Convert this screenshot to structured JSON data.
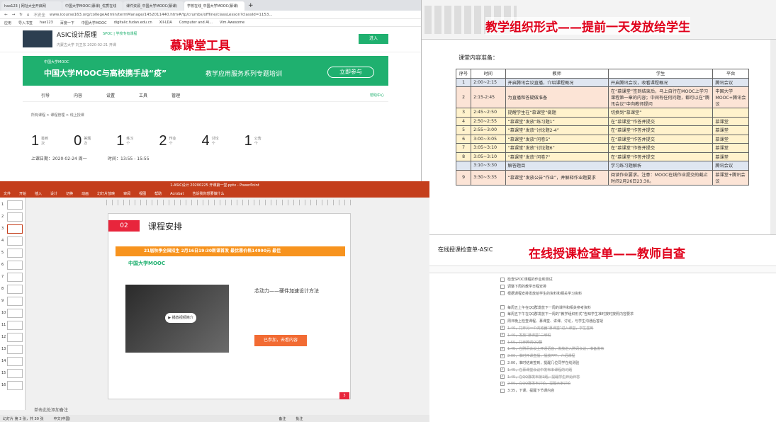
{
  "browser": {
    "tabs": [
      "hao123 | 网址大全开启网",
      "中国大学MOOC(慕课)_优质在线",
      "课件资源_中国大学MOOC(慕课)",
      "学校在线_中国大学MOOC(慕课)"
    ],
    "address": "www.icourse163.org/collegeAdmin/termManage/1452011440.htm#/tp/crumbs/offline/classLesson?classId=1153...",
    "insecure": "不安全",
    "bookmarks": [
      "应用",
      "导入书签",
      "hao123",
      "百度一下",
      "中国大学MOOC",
      "digitalic.fudan.edu.cn",
      "XII-LDA",
      "Computer and AI...",
      "Vim Awesome",
      "其他书签",
      "阅读清单",
      "自动翻译后"
    ],
    "course_title": "ASIC设计原理",
    "course_tags": "SPOC | 学校专有课程",
    "course_meta": "内蒙古大学  刘卫东      2020-02-21 开课",
    "enter_btn": "进入",
    "banner_logo": "中国大学MOOC",
    "banner_main": "中国大学MOOC与高校携手战“疫”",
    "banner_sub": "教学应用服务系列专题培训",
    "banner_btn": "立即参与",
    "subnav": [
      "引导",
      "内容",
      "设置",
      "工具",
      "管理"
    ],
    "help": "帮助中心",
    "breadcrumb": "所有课程  >  课程管理  >  线上授课",
    "stats": [
      {
        "n": "1",
        "l": "签到次"
      },
      {
        "n": "0",
        "l": "答题次"
      },
      {
        "n": "1",
        "l": "练习个"
      },
      {
        "n": "2",
        "l": "作业个"
      },
      {
        "n": "4",
        "l": "讨论个"
      },
      {
        "n": "1",
        "l": "公告个"
      }
    ],
    "date": "上课日期：2020-02-24 周一",
    "time": "时间：13:55 - 15:55"
  },
  "labels": {
    "tool": "慕课堂工具",
    "pdf": "教学组织形式——提前一天发放给学生",
    "check": "在线授课检查单——教师自查"
  },
  "pdf": {
    "heading": "课堂内容准备：",
    "headers": [
      "序号",
      "时间",
      "教师",
      "学生",
      "平台"
    ],
    "rows": [
      {
        "no": "1",
        "time": "2:00~2:15",
        "teacher": "开启腾讯会议直播，介绍课程概况",
        "student": "开启腾讯会议，收看课程概况",
        "platform": "腾讯会议",
        "bg": "#dfe6f1"
      },
      {
        "no": "2",
        "time": "2:15-2:45",
        "teacher": "为直播和答疑做准备",
        "student": "在“慕课堂”签到结束后，马上自行在MOOC上学习课程第一章的内容；中间有任何问题，都可以在“腾讯会议”中向教师提问",
        "platform": "中国大学MOOC+腾讯会议",
        "bg": "#fce4d6"
      },
      {
        "no": "3",
        "time": "2:45~2:50",
        "teacher": "提醒学生在“慕课堂”做题",
        "student": "切换到“慕课堂”",
        "platform": "",
        "bg": "#fff2cc"
      },
      {
        "no": "4",
        "time": "2:50~2:55",
        "teacher": "“慕课堂”发放“练习题1”",
        "student": "在“慕课堂”作答并提交",
        "platform": "慕课堂",
        "bg": "#fff2cc"
      },
      {
        "no": "5",
        "time": "2:55~3:00",
        "teacher": "“慕课堂”发放“讨论题2-4”",
        "student": "在“慕课堂”作答并提交",
        "platform": "慕课堂",
        "bg": "#fff2cc"
      },
      {
        "no": "6",
        "time": "3:00~3:05",
        "teacher": "“慕课堂”发放“问卷5”",
        "student": "在“慕课堂”作答并提交",
        "platform": "慕课堂",
        "bg": "#fff2cc"
      },
      {
        "no": "7",
        "time": "3:05~3:10",
        "teacher": "“慕课堂”发放“讨论题6”",
        "student": "在“慕课堂”作答并提交",
        "platform": "慕课堂",
        "bg": "#fff2cc"
      },
      {
        "no": "8",
        "time": "3:05~3:10",
        "teacher": "“慕课堂”发放“问卷7”",
        "student": "在“慕课堂”作答并提交",
        "platform": "慕课堂",
        "bg": "#fff2cc"
      },
      {
        "no": "",
        "time": "3:10~3:30",
        "teacher": "解答题目",
        "student": "学习练习题解析",
        "platform": "腾讯会议",
        "bg": "#dfe6f1"
      },
      {
        "no": "9",
        "time": "3:30~3:35",
        "teacher": "“慕课堂”发放公告“作业”，并解释作业题要求",
        "student": "阅读作业要求。注意：MOOC在线作业提交的截止时间2月26日23:30。",
        "platform": "慕课堂+腾讯会议",
        "bg": "#fce4d6"
      }
    ]
  },
  "ppt": {
    "title": "1-ASIC设计 20200225 开课第一堂.pptx - PowerPoint",
    "menu": [
      "文件",
      "开始",
      "插入",
      "设计",
      "切换",
      "动画",
      "幻灯片放映",
      "审阅",
      "视图",
      "帮助",
      "Acrobat",
      "告诉我你想要做什么"
    ],
    "slide_num": "02",
    "slide_title": "课程安排",
    "banner": "21届秋季全国招生  2月16日19:30新课首发  最优惠价格14990元 最佳",
    "mooc_logo": "中国大学MOOC",
    "video_title": "芯动力——硬件加速设计方法",
    "video_play": "播放视频简介",
    "enroll_btn": "已参加，去看内容",
    "notes": "单击此处添加备注",
    "status": [
      "幻灯片 第 3 张，共 30 张",
      "中文(中国)",
      "备注",
      "批注"
    ],
    "page_badge": "3",
    "thumb_nums": [
      "1",
      "2",
      "3",
      "4",
      "5",
      "6",
      "7",
      "8",
      "9",
      "10",
      "11",
      "12",
      "13",
      "14",
      "15",
      "16"
    ]
  },
  "check": {
    "title": "在线授课检查单-ASIC",
    "items": [
      {
        "t": "检查SPOC课程的作业和测试",
        "done": false
      },
      {
        "t": "调整下周的教学日程安排",
        "done": false
      },
      {
        "t": "根据课程安排发放给学生的资料和相关学习资料",
        "done": false
      },
      {
        "t": "课前",
        "done": false,
        "head": true
      },
      {
        "t": "每周五上午在QQ群发放下一周的课件和相关参考资料",
        "done": false
      },
      {
        "t": "每周五下午在QQ群发放下一周的“教学组织形式”告知学生准时按时按照内容要求",
        "done": false
      },
      {
        "t": "周日晚上检查课程、慕课堂、讲课、讨论，与学生沟通后答疑",
        "done": false
      },
      {
        "t": "1:40，打开另一个浏览器“慕课堂”进入课堂，学生签到",
        "done": true
      },
      {
        "t": "1:40，发放“慕课堂”二维码",
        "done": true
      },
      {
        "t": "1:55，打开腾讯QQ群",
        "done": true
      },
      {
        "t": "1:45，在腾讯会议上开通语音，发放进入腾讯会议，准备发布",
        "done": true
      },
      {
        "t": "2:00，准时开课直播，播放PPT，介绍课程",
        "done": true
      },
      {
        "t": "2:00，准时结束签到，提醒几位同学在线测验",
        "done": false
      },
      {
        "t": "1:45，在慕课堂会议中发布本课程的习题",
        "done": true
      },
      {
        "t": "1:45，在QQ群发布第1题，提醒学生开始作答",
        "done": true
      },
      {
        "t": "2:00，在QQ群发布讨论，提醒大家讨论",
        "done": true
      },
      {
        "t": "3:35，下课，提醒下节课内容",
        "done": false
      },
      {
        "t": "课后",
        "done": false,
        "head": true
      }
    ]
  }
}
